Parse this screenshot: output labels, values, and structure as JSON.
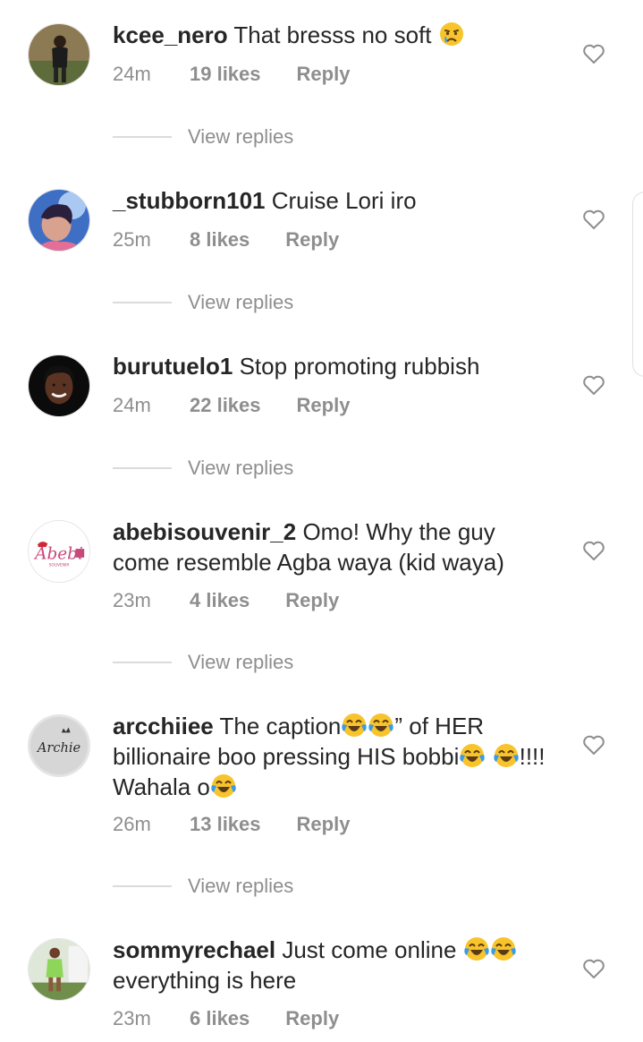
{
  "comments": [
    {
      "username": "kcee_nero",
      "text": "That bresss no soft",
      "time": "24m",
      "likes": "19 likes",
      "reply": "Reply",
      "view_replies": "View replies",
      "avatar_icon": "profile-photo-man-standing"
    },
    {
      "username": "_stubborn101",
      "text": "Cruise Lori iro",
      "time": "25m",
      "likes": "8 likes",
      "reply": "Reply",
      "view_replies": "View replies",
      "avatar_icon": "profile-photo-woman-blue"
    },
    {
      "username": "burutuelo1",
      "text": "Stop promoting rubbish",
      "time": "24m",
      "likes": "22 likes",
      "reply": "Reply",
      "view_replies": "View replies",
      "avatar_icon": "profile-photo-woman-smiling"
    },
    {
      "username": "abebisouvenir_2",
      "text": "Omo! Why the guy come resemble Agba waya (kid waya)",
      "time": "23m",
      "likes": "4 likes",
      "reply": "Reply",
      "view_replies": "View replies",
      "avatar_icon": "abebi-souvenir-logo"
    },
    {
      "username": "arcchiiee",
      "text_parts": [
        "The caption",
        "” of HER billionaire boo pressing HIS bobbi",
        "!!!! Wahala o"
      ],
      "time": "26m",
      "likes": "13 likes",
      "reply": "Reply",
      "view_replies": "View replies",
      "avatar_icon": "archie-logo"
    },
    {
      "username": "sommyrechael",
      "text_parts": [
        "Just come online ",
        " everything is here"
      ],
      "time": "23m",
      "likes": "6 likes",
      "reply": "Reply",
      "avatar_icon": "profile-photo-woman-green"
    }
  ],
  "colors": {
    "text": "#262626",
    "secondary": "#8e8e8e",
    "divider": "#dbdbdb"
  },
  "icons": {
    "like": "heart-outline-icon",
    "emoji_crying": "crying-face-emoji",
    "emoji_laughing": "face-with-tears-of-joy-emoji"
  }
}
